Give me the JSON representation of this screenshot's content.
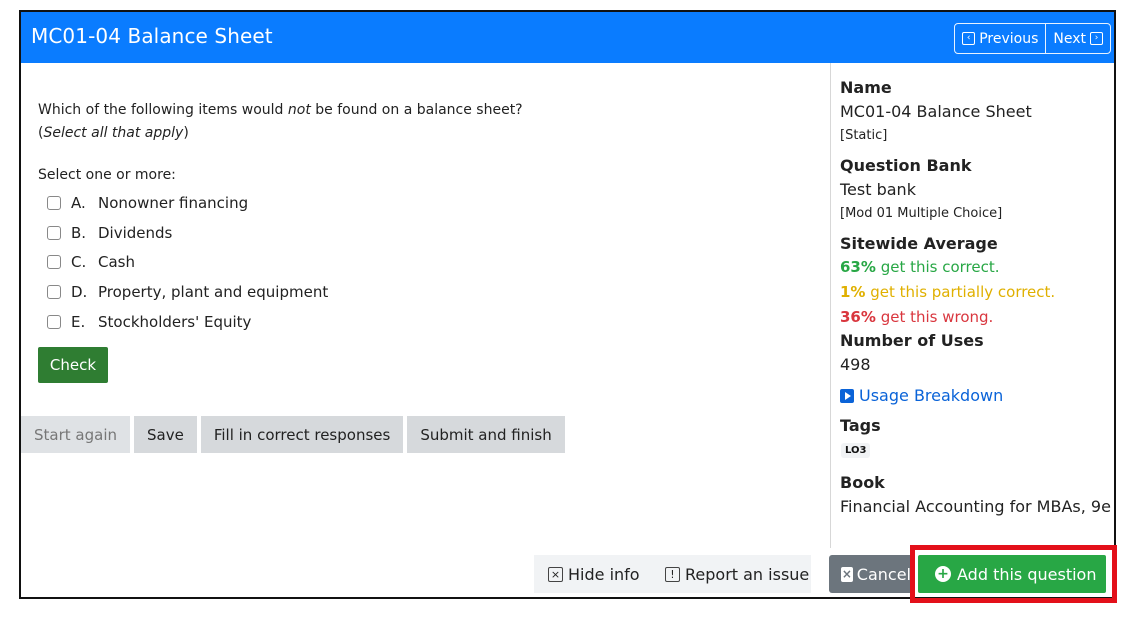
{
  "header": {
    "title": "MC01-04 Balance Sheet",
    "previous_label": "Previous",
    "next_label": "Next"
  },
  "question": {
    "line1_prefix": "Which of the following items would",
    "line1_emphasis": "not",
    "line1_suffix": "be found on a balance sheet?",
    "line2_open": "(",
    "line2_emphasis": "Select all that apply",
    "line2_close": ")",
    "select_prompt": "Select one or more:",
    "answers": [
      {
        "letter": "A.",
        "text": "Nonowner financing"
      },
      {
        "letter": "B.",
        "text": "Dividends"
      },
      {
        "letter": "C.",
        "text": "Cash"
      },
      {
        "letter": "D.",
        "text": "Property, plant and equipment"
      },
      {
        "letter": "E.",
        "text": "Stockholders' Equity"
      }
    ],
    "check_label": "Check"
  },
  "actions": {
    "start_again": "Start again",
    "save": "Save",
    "fill_correct": "Fill in correct responses",
    "submit_finish": "Submit and finish"
  },
  "sidebar": {
    "name_title": "Name",
    "name_value": "MC01-04 Balance Sheet",
    "name_type": "[Static]",
    "bank_title": "Question Bank",
    "bank_value": "Test bank",
    "bank_category": "[Mod 01 Multiple Choice]",
    "average_title": "Sitewide Average",
    "correct_pct": "63%",
    "correct_text": "get this correct.",
    "partial_pct": "1%",
    "partial_text": "get this partially correct.",
    "wrong_pct": "36%",
    "wrong_text": "get this wrong.",
    "uses_title": "Number of Uses",
    "uses_value": "498",
    "usage_link": "Usage Breakdown",
    "tags_title": "Tags",
    "tag": "LO3",
    "book_title": "Book",
    "book_value": "Financial Accounting for MBAs, 9e"
  },
  "footer": {
    "hide_info": "Hide info",
    "report_issue": "Report an issue",
    "cancel": "Cancel",
    "add_question": "Add this question"
  },
  "colors": {
    "header": "#0a7cff",
    "check": "#2f7d32",
    "correct": "#28a745",
    "partial": "#e0b000",
    "wrong": "#d9363e",
    "highlight": "#e3101a"
  },
  "icons": {
    "previous": "chevron-left-square-icon",
    "next": "chevron-right-square-icon",
    "hide_info": "close-square-icon",
    "report": "exclamation-square-icon",
    "cancel": "close-square-icon",
    "add": "plus-circle-icon",
    "usage": "play-square-icon"
  }
}
